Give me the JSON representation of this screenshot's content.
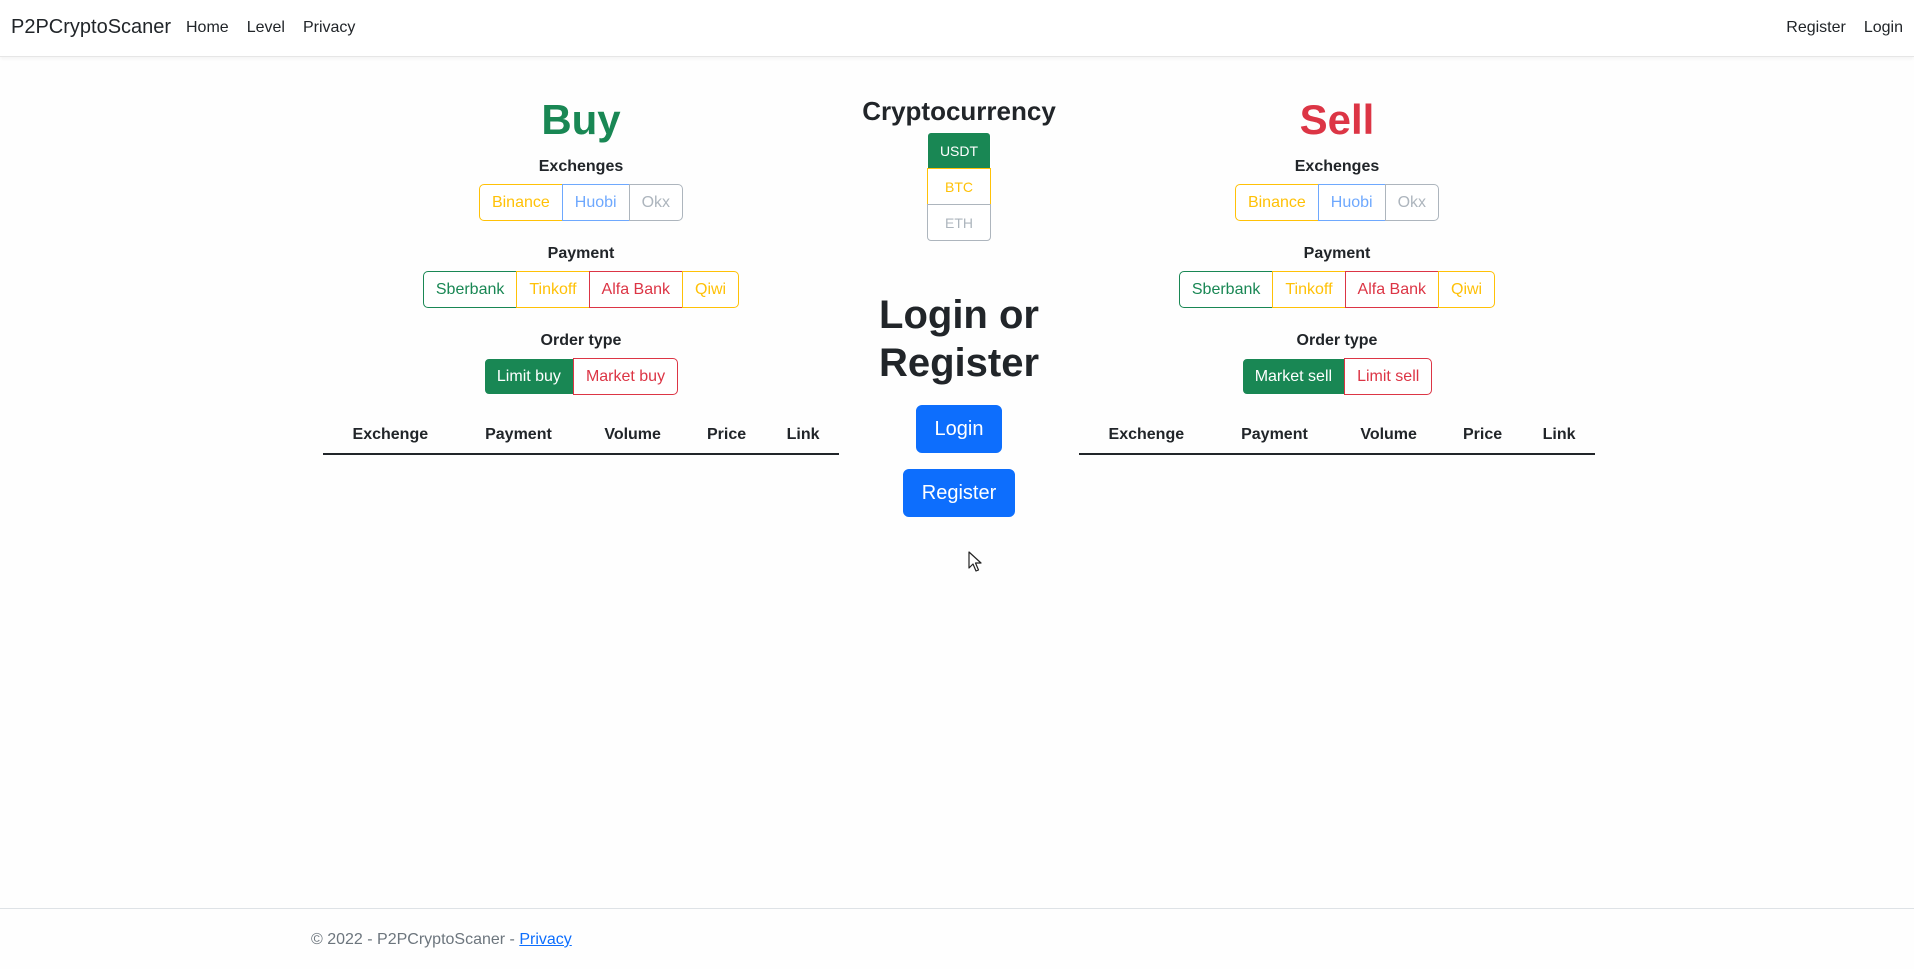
{
  "navbar": {
    "brand": "P2PCryptoScaner",
    "left_links": [
      "Home",
      "Level",
      "Privacy"
    ],
    "right_links": [
      "Register",
      "Login"
    ]
  },
  "buy": {
    "title": "Buy",
    "exchanges_label": "Exchenges",
    "exchanges": [
      "Binance",
      "Huobi",
      "Okx"
    ],
    "payment_label": "Payment",
    "payments": [
      "Sberbank",
      "Tinkoff",
      "Alfa Bank",
      "Qiwi"
    ],
    "order_type_label": "Order type",
    "order_types": [
      "Limit buy",
      "Market buy"
    ],
    "table_headers": [
      "Exchenge",
      "Payment",
      "Volume",
      "Price",
      "Link"
    ]
  },
  "sell": {
    "title": "Sell",
    "exchanges_label": "Exchenges",
    "exchanges": [
      "Binance",
      "Huobi",
      "Okx"
    ],
    "payment_label": "Payment",
    "payments": [
      "Sberbank",
      "Tinkoff",
      "Alfa Bank",
      "Qiwi"
    ],
    "order_type_label": "Order type",
    "order_types": [
      "Market sell",
      "Limit sell"
    ],
    "table_headers": [
      "Exchenge",
      "Payment",
      "Volume",
      "Price",
      "Link"
    ]
  },
  "crypto": {
    "title": "Cryptocurrency",
    "options": [
      "USDT",
      "BTC",
      "ETH"
    ],
    "selected": "USDT"
  },
  "auth": {
    "title": "Login or Register",
    "login_label": "Login",
    "register_label": "Register"
  },
  "footer": {
    "text": "© 2022 - P2PCryptoScaner - ",
    "privacy_link": "Privacy"
  },
  "colors": {
    "success": "#198754",
    "danger": "#dc3545",
    "warning": "#ffc107",
    "primary": "#0d6efd",
    "info_light": "#6ea8fe",
    "secondary": "#adb5bd"
  }
}
